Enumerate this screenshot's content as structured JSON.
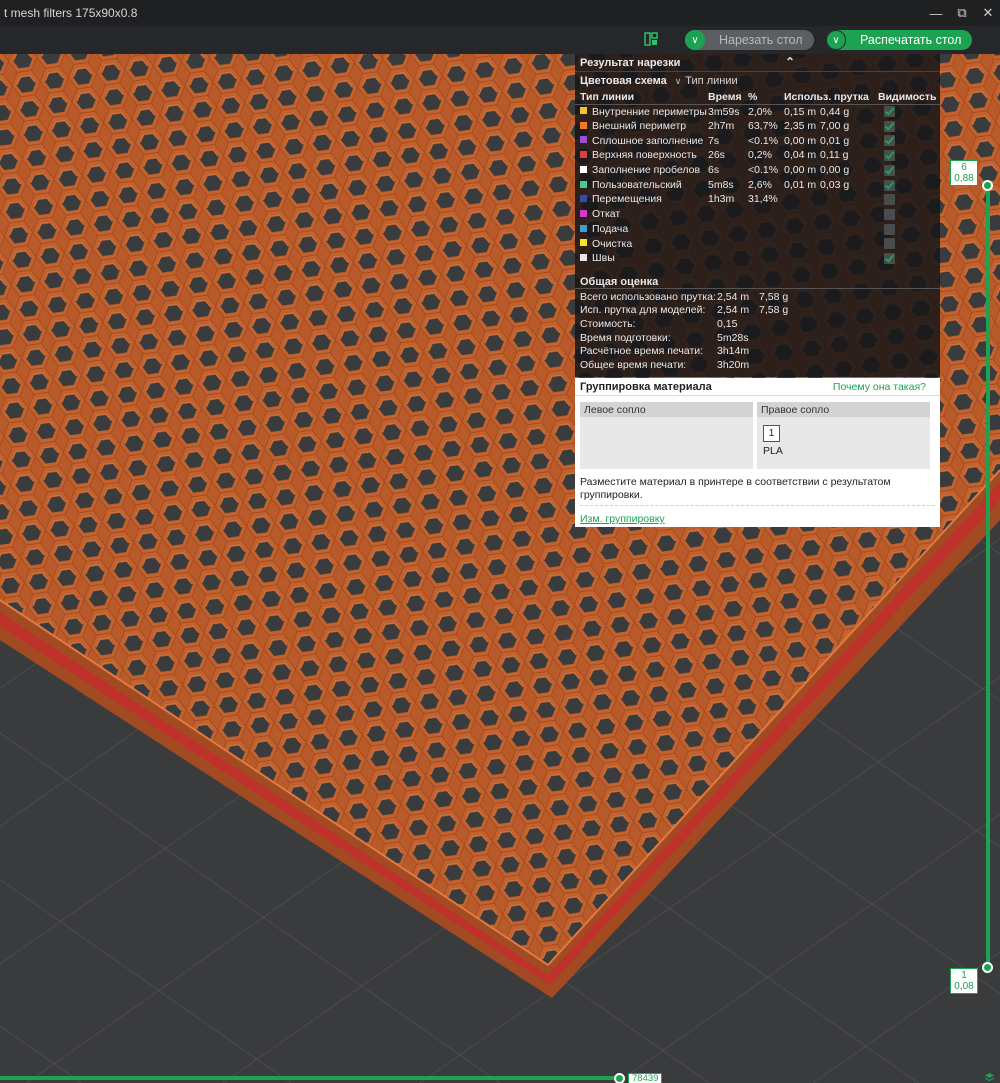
{
  "window": {
    "title": "t mesh filters 175x90x0.8",
    "min_icon": "minimize-icon",
    "max_icon": "restore-icon",
    "close_icon": "close-icon"
  },
  "toolbar": {
    "slice_label": "Нарезать стол",
    "print_label": "Распечатать стол"
  },
  "slice_result": {
    "title": "Результат нарезки",
    "color_scheme_label": "Цветовая схема",
    "color_scheme_value": "Тип линии",
    "columns": [
      "Тип линии",
      "Время",
      "%",
      "Использ. прутка",
      "Видимость"
    ],
    "rows": [
      {
        "name": "Внутренние периметры",
        "color": "#f2c230",
        "time": "3m59s",
        "pct": "2,0%",
        "len": "0,15 m",
        "wt": "0,44 g",
        "visible": true
      },
      {
        "name": "Внешний периметр",
        "color": "#f07a2a",
        "time": "2h7m",
        "pct": "63,7%",
        "len": "2,35 m",
        "wt": "7,00 g",
        "visible": true
      },
      {
        "name": "Сплошное заполнение",
        "color": "#9a4fd1",
        "time": "7s",
        "pct": "<0.1%",
        "len": "0,00 m",
        "wt": "0,01 g",
        "visible": true
      },
      {
        "name": "Верхняя поверхность",
        "color": "#e63a3a",
        "time": "26s",
        "pct": "0,2%",
        "len": "0,04 m",
        "wt": "0,11 g",
        "visible": true
      },
      {
        "name": "Заполнение пробелов",
        "color": "#ffffff",
        "time": "6s",
        "pct": "<0.1%",
        "len": "0,00 m",
        "wt": "0,00 g",
        "visible": true
      },
      {
        "name": "Пользовательский",
        "color": "#4fc98a",
        "time": "5m8s",
        "pct": "2,6%",
        "len": "0,01 m",
        "wt": "0,03 g",
        "visible": true
      },
      {
        "name": "Перемещения",
        "color": "#3a4aa8",
        "time": "1h3m",
        "pct": "31,4%",
        "len": "",
        "wt": "",
        "visible": false
      },
      {
        "name": "Откат",
        "color": "#d03ad0",
        "time": "",
        "pct": "",
        "len": "",
        "wt": "",
        "visible": false
      },
      {
        "name": "Подача",
        "color": "#3aa0d0",
        "time": "",
        "pct": "",
        "len": "",
        "wt": "",
        "visible": false
      },
      {
        "name": "Очистка",
        "color": "#f5e52a",
        "time": "",
        "pct": "",
        "len": "",
        "wt": "",
        "visible": false
      },
      {
        "name": "Швы",
        "color": "#e6e6e6",
        "time": "",
        "pct": "",
        "len": "",
        "wt": "",
        "visible": true
      }
    ]
  },
  "summary": {
    "title": "Общая оценка",
    "rows": [
      {
        "key": "Всего использовано прутка:",
        "v1": "2,54 m",
        "v2": "7,58 g"
      },
      {
        "key": "Исп. прутка для моделей:",
        "v1": "2,54 m",
        "v2": "7,58 g"
      },
      {
        "key": "Стоимость:",
        "v1": "0,15",
        "v2": ""
      },
      {
        "key": "Время подготовки:",
        "v1": "5m28s",
        "v2": ""
      },
      {
        "key": "Расчётное время печати:",
        "v1": "3h14m",
        "v2": ""
      },
      {
        "key": "Общее время печати:",
        "v1": "3h20m",
        "v2": ""
      }
    ]
  },
  "material_grouping": {
    "title": "Группировка материала",
    "why_link": "Почему она такая?",
    "left_nozzle": "Левое сопло",
    "right_nozzle": "Правое сопло",
    "filament_index": "1",
    "filament_name": "PLA",
    "note": "Разместите материал в принтере в соответствии с результатом группировки.",
    "change_link": "Изм. группировку"
  },
  "layer_slider": {
    "top_layer": "6",
    "top_height": "0,88",
    "bottom_layer": "1",
    "bottom_height": "0,08"
  },
  "move_slider": {
    "value": "78439"
  },
  "colors": {
    "accent": "#1da252",
    "model_orange": "#c4622d",
    "bed": "#3a3b3d"
  }
}
